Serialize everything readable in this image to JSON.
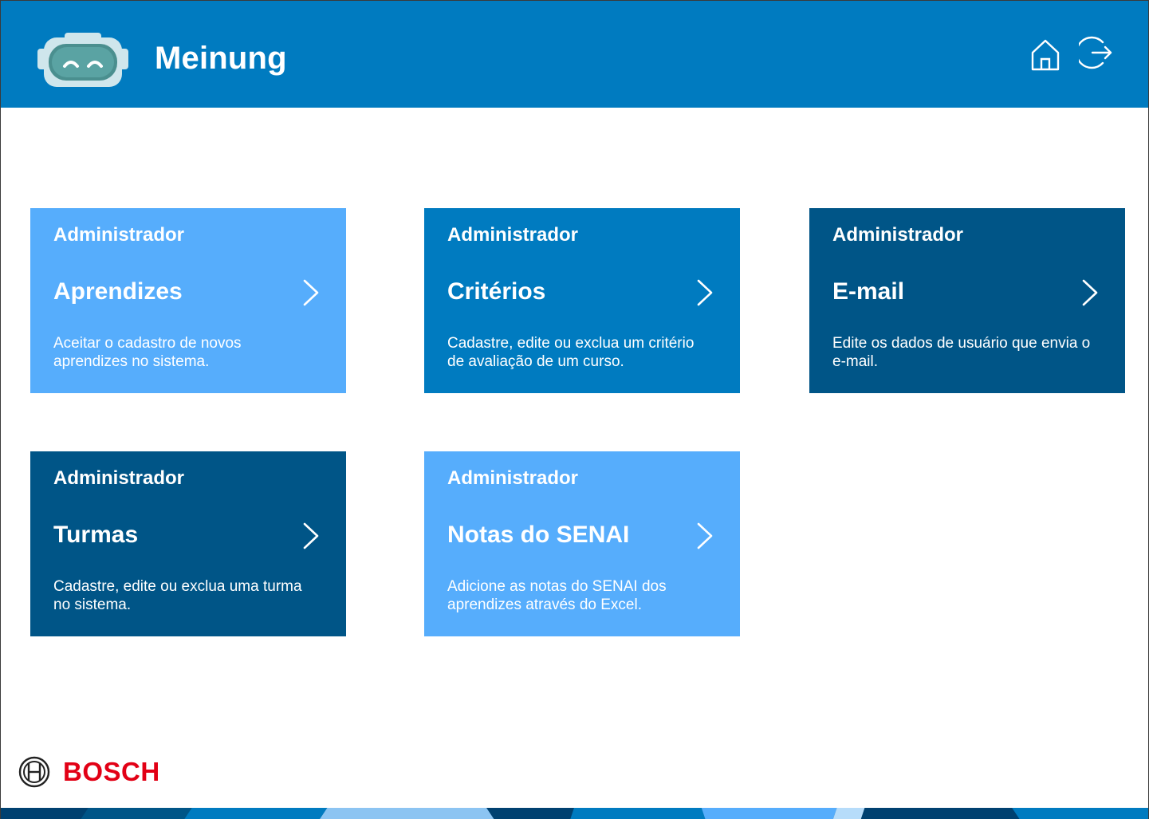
{
  "header": {
    "app_name": "Meinung",
    "home_icon": "home-icon",
    "logout_icon": "logout-icon"
  },
  "cards": [
    {
      "role": "Administrador",
      "title": "Aprendizes",
      "description": "Aceitar o cadastro de novos aprendizes no sistema.",
      "color": "#56adfc"
    },
    {
      "role": "Administrador",
      "title": "Critérios",
      "description": "Cadastre, edite ou exclua um critério de avaliação de um curso.",
      "color": "#007bc0"
    },
    {
      "role": "Administrador",
      "title": "E-mail",
      "description": "Edite os dados de usuário que envia o e-mail.",
      "color": "#005587"
    },
    {
      "role": "Administrador",
      "title": "Turmas",
      "description": "Cadastre, edite ou exclua uma turma no sistema.",
      "color": "#005587"
    },
    {
      "role": "Administrador",
      "title": "Notas do SENAI",
      "description": "Adicione as notas do SENAI dos aprendizes através do Excel.",
      "color": "#56adfc"
    }
  ],
  "footer": {
    "brand": "BOSCH"
  },
  "colors": {
    "header_bg": "#007bc0",
    "card_light": "#56adfc",
    "card_mid": "#007bc0",
    "card_dark": "#005587",
    "bosch_red": "#e20015"
  }
}
